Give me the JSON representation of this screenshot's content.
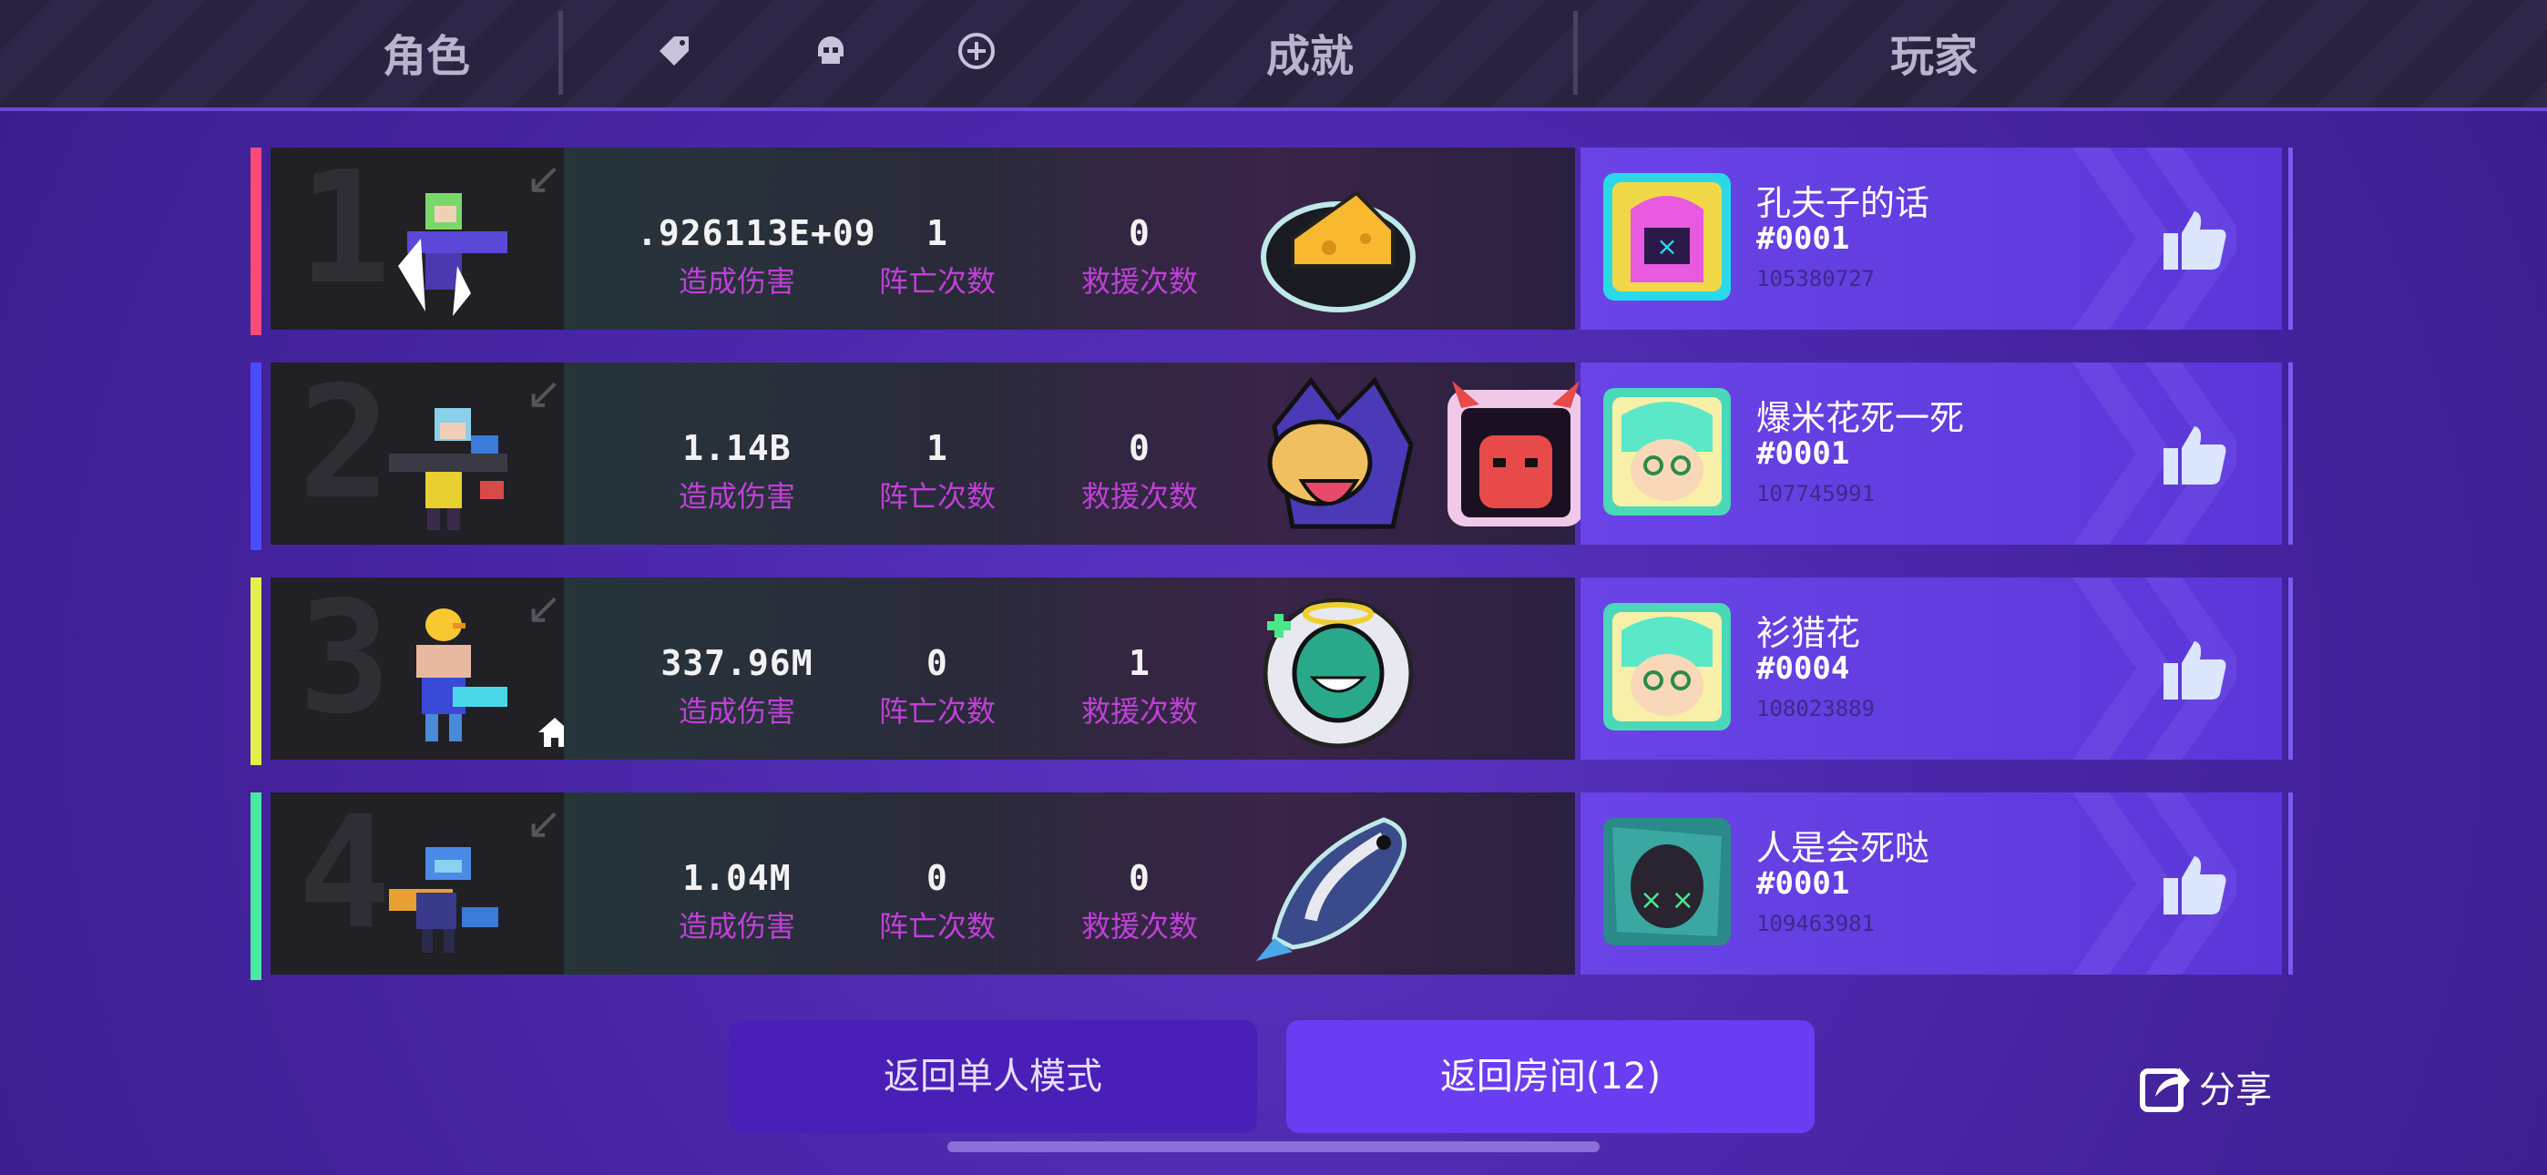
{
  "header": {
    "role_label": "角色",
    "achievement_label": "成就",
    "player_label": "玩家",
    "icons": [
      "tag-icon",
      "skull-icon",
      "plus-circle-icon"
    ]
  },
  "rows": [
    {
      "rank": "1",
      "edge_color": "#ff4a78",
      "damage": ".926113E+09",
      "damage_label": "造成伤害",
      "deaths": "1",
      "deaths_label": "阵亡次数",
      "rescues": "0",
      "rescues_label": "救援次数",
      "achievements": [
        "cheese-badge-icon"
      ],
      "player": {
        "name": "孔夫子的话",
        "tag": "#0001",
        "id": "105380727"
      }
    },
    {
      "rank": "2",
      "edge_color": "#4a4cff",
      "damage": "1.14B",
      "damage_label": "造成伤害",
      "deaths": "1",
      "deaths_label": "阵亡次数",
      "rescues": "0",
      "rescues_label": "救援次数",
      "achievements": [
        "wolf-badge-icon",
        "devil-badge-icon"
      ],
      "player": {
        "name": "爆米花死一死",
        "tag": "#0001",
        "id": "107745991"
      }
    },
    {
      "rank": "3",
      "edge_color": "#e4f04a",
      "damage": "337.96M",
      "damage_label": "造成伤害",
      "deaths": "0",
      "deaths_label": "阵亡次数",
      "rescues": "1",
      "rescues_label": "救援次数",
      "achievements": [
        "angel-badge-icon"
      ],
      "player": {
        "name": "衫猎花",
        "tag": "#0004",
        "id": "108023889"
      }
    },
    {
      "rank": "4",
      "edge_color": "#4ae8a0",
      "damage": "1.04M",
      "damage_label": "造成伤害",
      "deaths": "0",
      "deaths_label": "阵亡次数",
      "rescues": "0",
      "rescues_label": "救援次数",
      "achievements": [
        "fish-badge-icon"
      ],
      "player": {
        "name": "人是会死哒",
        "tag": "#0001",
        "id": "109463981"
      }
    }
  ],
  "buttons": {
    "solo": "返回单人模式",
    "room": "返回房间(12)",
    "share": "分享"
  }
}
